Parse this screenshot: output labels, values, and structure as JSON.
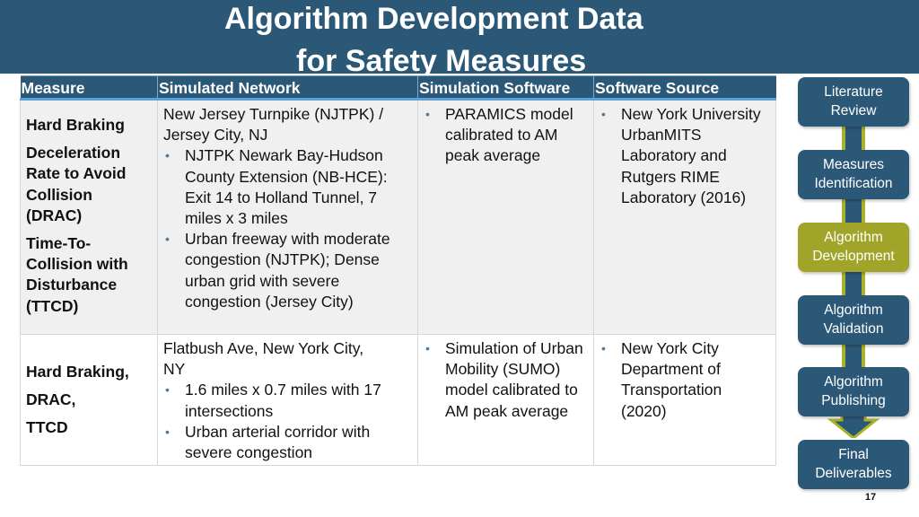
{
  "slide": {
    "title_lines": [
      "Algorithm Development Data",
      "for Safety Measures"
    ],
    "page_number": "17",
    "colors": {
      "primary": "#2c5877",
      "accent": "#a0a529",
      "header_rule": "#5aa2d9"
    }
  },
  "table": {
    "headers": [
      "Measure",
      "Simulated Network",
      "Simulation Software",
      "Software Source"
    ],
    "rows": [
      {
        "measures": [
          [
            "Hard Braking"
          ],
          [
            "Deceleration",
            "Rate to Avoid",
            "Collision",
            "(DRAC)"
          ],
          [
            "Time-To-",
            "Collision with",
            "Disturbance",
            "(TTCD)"
          ]
        ],
        "network_intro": [
          "New Jersey Turnpike (NJTPK) /",
          "Jersey City, NJ"
        ],
        "network_bullets": [
          "NJTPK Newark Bay-Hudson County Extension (NB-HCE): Exit 14 to Holland Tunnel, 7 miles x 3 miles",
          "Urban freeway with moderate congestion (NJTPK); Dense urban grid with severe congestion (Jersey City)"
        ],
        "software_bullets": [
          "PARAMICS model calibrated to AM peak average"
        ],
        "source_bullets": [
          "New York University UrbanMITS Laboratory and Rutgers RIME Laboratory (2016)"
        ]
      },
      {
        "measures": [
          "Hard Braking,",
          "DRAC,",
          "TTCD"
        ],
        "network_intro": [
          "Flatbush Ave, New York City,",
          "NY"
        ],
        "network_bullets": [
          "1.6 miles x 0.7 miles with 17 intersections",
          "Urban arterial corridor with severe congestion"
        ],
        "software_bullets": [
          "Simulation of Urban Mobility (SUMO) model calibrated to AM peak average"
        ],
        "source_bullets": [
          "New York City Department of Transportation (2020)"
        ]
      }
    ]
  },
  "flow": {
    "steps": [
      {
        "lines": [
          "Literature",
          "Review"
        ],
        "active": false
      },
      {
        "lines": [
          "Measures",
          "Identification"
        ],
        "active": false
      },
      {
        "lines": [
          "Algorithm",
          "Development"
        ],
        "active": true
      },
      {
        "lines": [
          "Algorithm",
          "Validation"
        ],
        "active": false
      },
      {
        "lines": [
          "Algorithm",
          "Publishing"
        ],
        "active": false
      },
      {
        "lines": [
          "Final",
          "Deliverables"
        ],
        "active": false
      }
    ],
    "icons": [
      "connector",
      "down-arrow-icon"
    ]
  }
}
